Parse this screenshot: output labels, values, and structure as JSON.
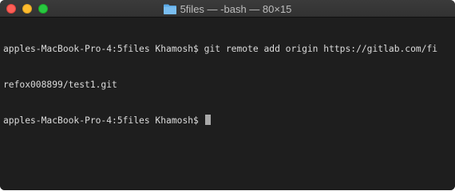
{
  "window": {
    "title": "5files — -bash — 80×15",
    "folder_icon": "folder-icon"
  },
  "terminal": {
    "lines": [
      "apples-MacBook-Pro-4:5files Khamosh$ git remote add origin https://gitlab.com/fi",
      "refox008899/test1.git",
      "apples-MacBook-Pro-4:5files Khamosh$ "
    ],
    "colors": {
      "background": "#1e1e1e",
      "text": "#dcdcdc",
      "cursor": "#a9a9a9"
    }
  }
}
